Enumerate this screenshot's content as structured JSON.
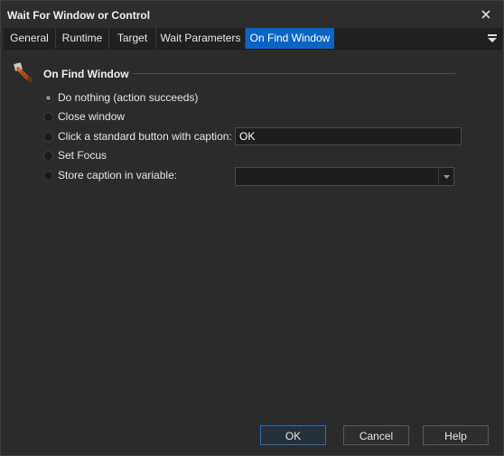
{
  "window": {
    "title": "Wait For Window or Control"
  },
  "tabs": [
    {
      "label": "General"
    },
    {
      "label": "Runtime"
    },
    {
      "label": "Target"
    },
    {
      "label": "Wait Parameters"
    },
    {
      "label": "On Find Window",
      "active": true
    }
  ],
  "section": {
    "title": "On Find Window",
    "icon": "action-tool-icon"
  },
  "options": [
    {
      "label": "Do nothing (action succeeds)",
      "checked": true
    },
    {
      "label": "Close window",
      "checked": false
    },
    {
      "label": "Click a standard button with caption:",
      "checked": false
    },
    {
      "label": "Set Focus",
      "checked": false
    },
    {
      "label": "Store caption in variable:",
      "checked": false
    }
  ],
  "caption_input": {
    "value": "OK"
  },
  "variable_select": {
    "value": ""
  },
  "buttons": {
    "ok": "OK",
    "cancel": "Cancel",
    "help": "Help"
  },
  "colors": {
    "accent": "#0a64c8",
    "background": "#2b2b2b",
    "tabbar": "#202020"
  }
}
